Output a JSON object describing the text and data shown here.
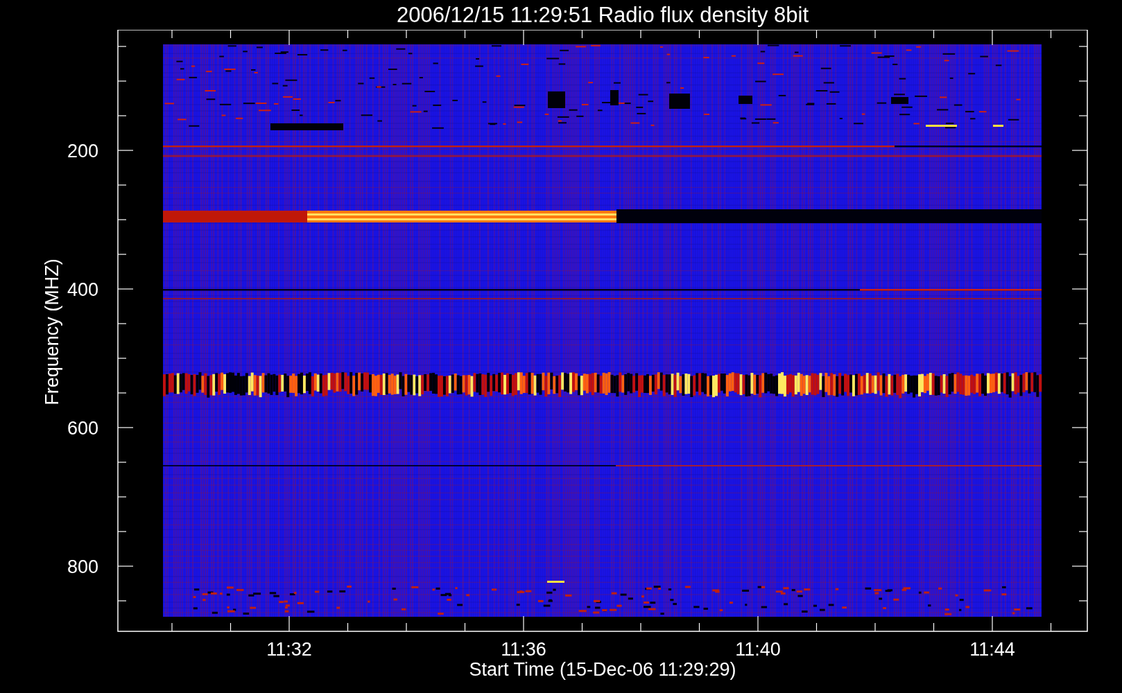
{
  "title": "2006/12/15 11:29:51 Radio flux density 8bit",
  "plot": {
    "ylabel": "Frequency (MHZ)",
    "xlabel": "Start Time (15-Dec-06 11:29:29)",
    "yticks": [
      "200",
      "400",
      "600",
      "800"
    ],
    "xticks": [
      "11:32",
      "11:36",
      "11:40",
      "11:44"
    ]
  }
}
